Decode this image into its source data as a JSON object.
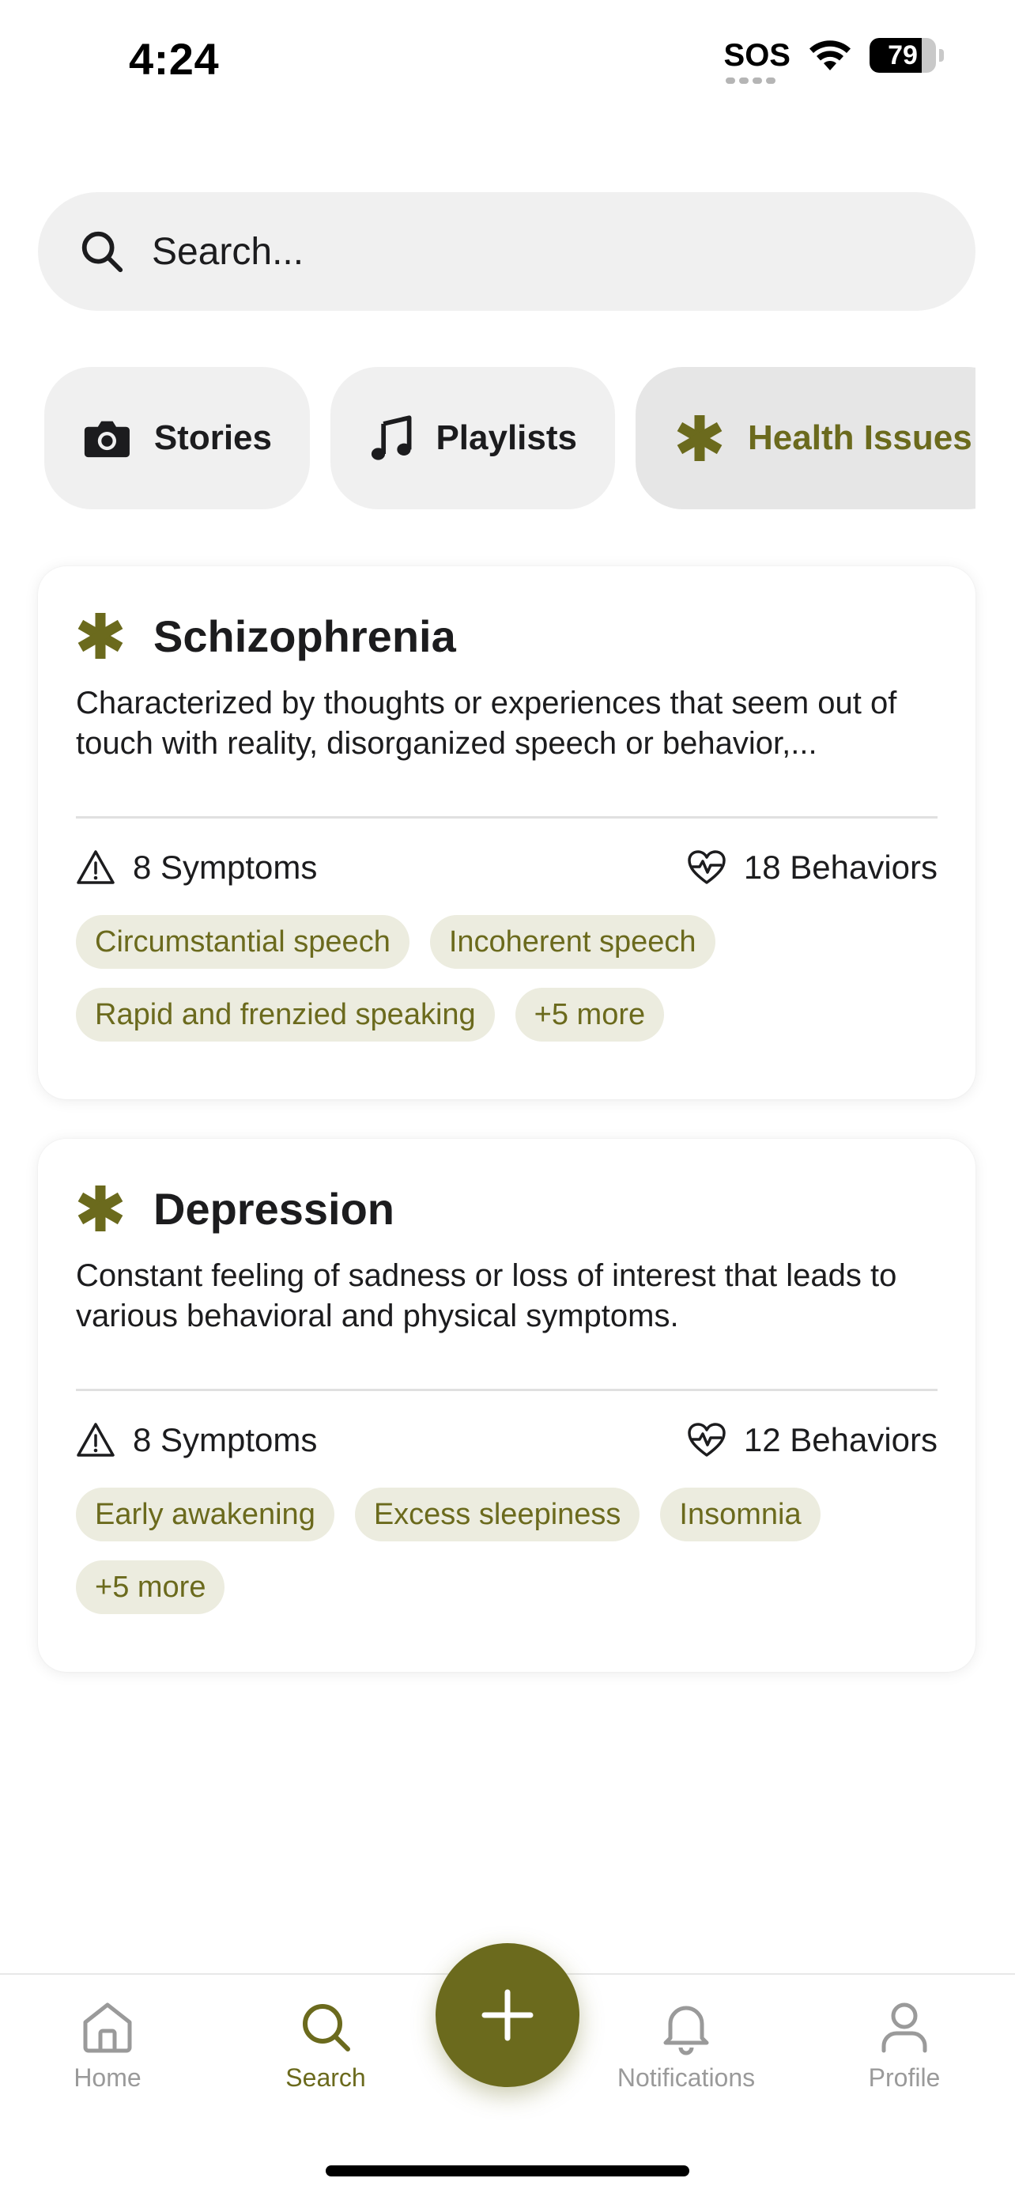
{
  "status_bar": {
    "time": "4:24",
    "sos": "SOS",
    "battery": "79",
    "battery_level": 0.79,
    "icons": [
      "sos-indicator",
      "wifi-icon",
      "battery-icon"
    ]
  },
  "search": {
    "placeholder": "Search...",
    "value": ""
  },
  "chips": [
    {
      "label": "Stories",
      "icon": "camera-icon",
      "active": false
    },
    {
      "label": "Playlists",
      "icon": "music-note-icon",
      "active": false
    },
    {
      "label": "Health Issues",
      "icon": "asterisk-icon",
      "active": true
    }
  ],
  "cards": [
    {
      "title": "Schizophrenia",
      "icon": "asterisk-icon",
      "description": "Characterized by thoughts or experiences that seem out of touch with reality, disorganized speech or behavior,...",
      "symptoms": "8 Symptoms",
      "behaviors": "18 Behaviors",
      "tags": [
        "Circumstantial speech",
        "Incoherent speech",
        "Rapid and frenzied speaking",
        "+5 more"
      ]
    },
    {
      "title": "Depression",
      "icon": "asterisk-icon",
      "description": "Constant feeling of sadness or loss of interest that leads to various behavioral and physical symptoms.",
      "symptoms": "8 Symptoms",
      "behaviors": "12 Behaviors",
      "tags": [
        "Early awakening",
        "Excess sleepiness",
        "Insomnia",
        "+5 more"
      ]
    }
  ],
  "nav": {
    "items": [
      {
        "label": "Home",
        "icon": "home-icon",
        "active": false
      },
      {
        "label": "Search",
        "icon": "search-icon",
        "active": true
      },
      {
        "label": "Notifications",
        "icon": "bell-icon",
        "active": false
      },
      {
        "label": "Profile",
        "icon": "person-icon",
        "active": false
      }
    ],
    "fab_icon": "plus-icon"
  },
  "colors": {
    "accent": "#6b6a1d",
    "tag_bg": "#ececdf",
    "chip_bg": "#f0f0f0",
    "inactive_nav": "#9a9a9a"
  }
}
